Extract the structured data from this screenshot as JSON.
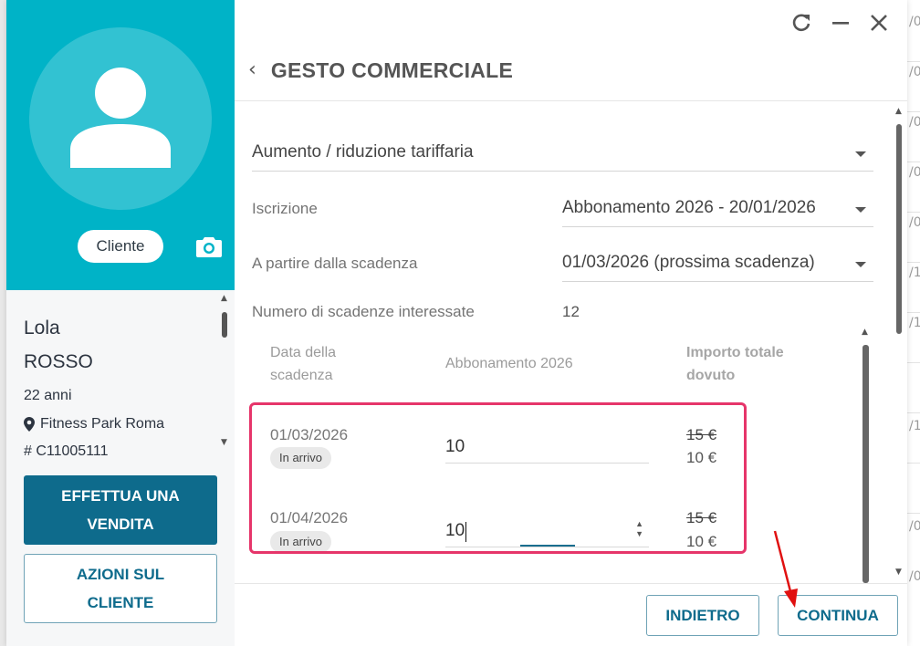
{
  "background": {
    "row_fragments": [
      "/0",
      "/0",
      "/0",
      "/0",
      "/0",
      "/1",
      "/1",
      "/1",
      "/0",
      "/0"
    ]
  },
  "window": {
    "refresh_icon": "refresh-icon",
    "minimize_icon": "minimize-icon",
    "close_icon": "close-icon"
  },
  "profile": {
    "role_chip": "Cliente",
    "first_name": "Lola",
    "last_name": "ROSSO",
    "age": "22 anni",
    "club": "Fitness Park Roma",
    "member_code": "# C11005111",
    "sale_button": [
      "EFFETTUA UNA",
      "VENDITA"
    ],
    "actions_button": [
      "AZIONI SUL",
      "CLIENTE"
    ]
  },
  "form": {
    "title": "GESTO COMMERCIALE",
    "type_select": "Aumento / riduzione tariffaria",
    "subscription_label": "Iscrizione",
    "subscription_value": "Abbonamento 2026 - 20/01/2026",
    "start_label": "A partire dalla scadenza",
    "start_value": "01/03/2026 (prossima scadenza)",
    "count_label": "Numero di scadenze interessate",
    "count_value": "12"
  },
  "table": {
    "headers": {
      "date": [
        "Data della",
        "scadenza"
      ],
      "plan": "Abbonamento 2026",
      "total": [
        "Importo totale",
        "dovuto"
      ]
    },
    "rows": [
      {
        "date": "01/03/2026",
        "status": "In arrivo",
        "amount": "10",
        "old_price": "15 €",
        "new_price": "10 €"
      },
      {
        "date": "01/04/2026",
        "status": "In arrivo",
        "amount": "10",
        "old_price": "15 €",
        "new_price": "10 €"
      }
    ]
  },
  "footer": {
    "back_label": "INDIETRO",
    "next_label": "CONTINUA"
  },
  "colors": {
    "teal": "#00b3c7",
    "primary": "#0e6b8c",
    "highlight": "#e6356a",
    "annotation_arrow": "#e01010"
  }
}
